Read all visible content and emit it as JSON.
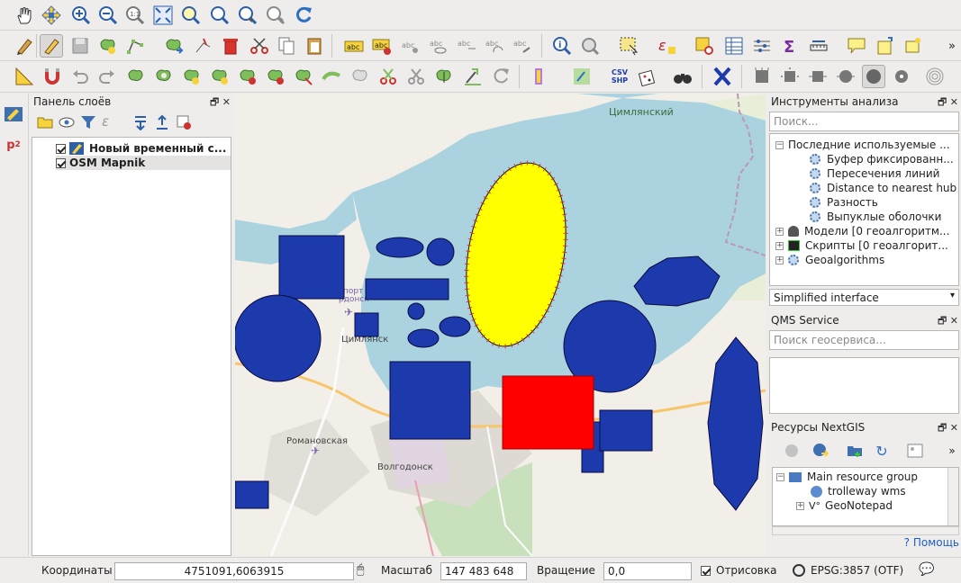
{
  "layers_panel": {
    "title": "Панель слоёв",
    "layers": [
      {
        "name": "Новый временный с...",
        "checked": true
      },
      {
        "name": "OSM Mapnik",
        "checked": true
      }
    ]
  },
  "analysis_panel": {
    "title": "Инструменты анализа",
    "search_placeholder": "Поиск...",
    "recent_group": "Последние используемые ...",
    "recent_items": [
      "Буфер фиксированн...",
      "Пересечения линий",
      "Distance to nearest hub",
      "Разность",
      "Выпуклые оболочки"
    ],
    "groups": [
      "Модели [0 геоалгоритм...",
      "Скрипты [0 геоалгорит...",
      "Geoalgorithms"
    ],
    "interface_mode": "Simplified interface"
  },
  "qms_panel": {
    "title": "QMS Service",
    "search_placeholder": "Поиск геосервиса..."
  },
  "nextgis_panel": {
    "title": "Ресурсы NextGIS",
    "tree": [
      "Main resource group",
      "trolleway wms",
      "GeoNotepad"
    ],
    "help_link": "? Помощь"
  },
  "map": {
    "labels": {
      "tsimlyansky_top": "Цимлянский",
      "tsimlyansk": "Цимлянск",
      "romanovskaya": "Романовская",
      "volgodonsk": "Волгодонск",
      "airport": "порт",
      "airport2": "рдонск"
    },
    "colors": {
      "water": "#aad3df",
      "land": "#f2efe9",
      "park": "#c8e1bc",
      "feature_fill": "#1c3aab",
      "selected_fill": "#ffff00",
      "highlight_fill": "#ff0000"
    }
  },
  "statusbar": {
    "coords_label": "Координаты",
    "coords_value": "4751091,6063915",
    "scale_label": "Масштаб",
    "scale_value": "147 483 648",
    "rotation_label": "Вращение",
    "rotation_value": "0,0",
    "render_label": "Отрисовка",
    "crs": "EPSG:3857 (OTF)"
  },
  "toolbar_icons": {
    "row1": [
      "pan-icon",
      "pan-to-selection-icon",
      "zoom-in-icon",
      "zoom-out-icon",
      "zoom-actual-icon",
      "zoom-full-icon",
      "zoom-selection-icon",
      "zoom-layer-icon",
      "zoom-last-icon",
      "zoom-next-icon",
      "refresh-icon"
    ],
    "csv_shp_label": "CSV\nSHP"
  }
}
